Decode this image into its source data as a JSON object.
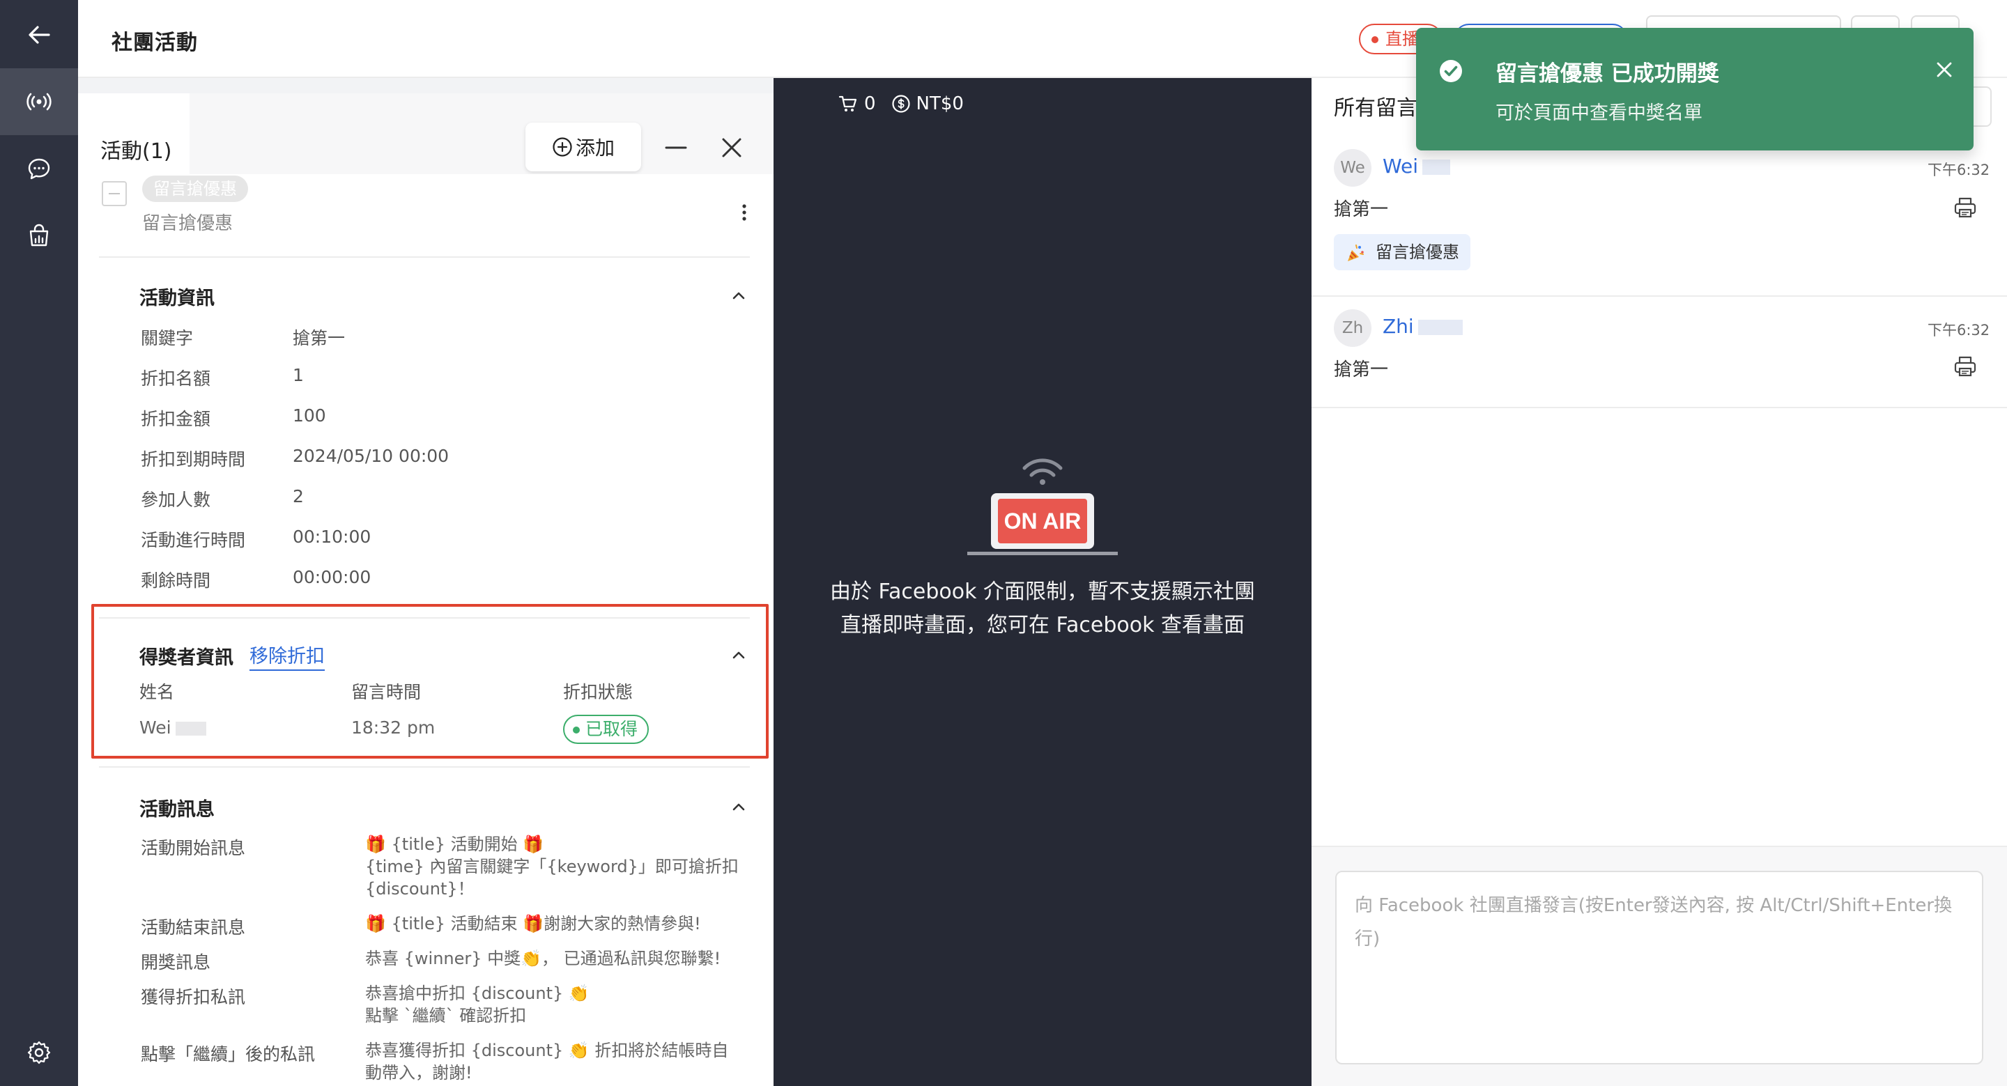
{
  "header": {
    "title": "社團活動",
    "live_badge": "直播"
  },
  "panel": {
    "title": "活動(1)",
    "add_label": "添加",
    "activity_tag": "留言搶優惠",
    "activity_name": "留言搶優惠"
  },
  "activity_info": {
    "title": "活動資訊",
    "rows": [
      {
        "label": "關鍵字",
        "value": "搶第一"
      },
      {
        "label": "折扣名額",
        "value": "1"
      },
      {
        "label": "折扣金額",
        "value": "100"
      },
      {
        "label": "折扣到期時間",
        "value": "2024/05/10 00:00"
      },
      {
        "label": "參加人數",
        "value": "2"
      },
      {
        "label": "活動進行時間",
        "value": "00:10:00"
      },
      {
        "label": "剩餘時間",
        "value": "00:00:00"
      }
    ]
  },
  "winner_info": {
    "title": "得獎者資訊",
    "remove_link": "移除折扣",
    "columns": [
      "姓名",
      "留言時間",
      "折扣狀態"
    ],
    "row": {
      "name": "Wei",
      "time": "18:32 pm",
      "status": "已取得"
    }
  },
  "activity_messages": {
    "title": "活動訊息",
    "items": [
      {
        "label": "活動開始訊息",
        "lines": [
          "🎁 {title} 活動開始 🎁",
          "{time} 內留言關鍵字「{keyword}」即可搶折扣",
          "{discount}！"
        ]
      },
      {
        "label": "活動結束訊息",
        "lines": [
          "🎁 {title} 活動結束 🎁謝謝大家的熱情參與!"
        ]
      },
      {
        "label": "開獎訊息",
        "lines": [
          "恭喜 {winner} 中獎👏， 已通過私訊與您聯繫!"
        ]
      },
      {
        "label": "獲得折扣私訊",
        "lines": [
          "恭喜搶中折扣 {discount} 👏",
          "點擊 `繼續` 確認折扣"
        ]
      },
      {
        "label": "點擊「繼續」後的私訊",
        "lines": [
          "恭喜獲得折扣 {discount} 👏 折扣將於結帳時自",
          "動帶入，謝謝!"
        ]
      }
    ]
  },
  "video": {
    "cart_count": "0",
    "amount": "NT$0",
    "onair_label": "ON AIR",
    "notice": "由於 Facebook 介面限制，暫不支援顯示社團直播即時畫面，您可在 Facebook 查看畫面"
  },
  "comments": {
    "title": "所有留言",
    "items": [
      {
        "avatar": "We",
        "name": "Wei",
        "time": "下午6:32",
        "text": "搶第一",
        "tag": "留言搶優惠"
      },
      {
        "avatar": "Zh",
        "name": "Zhi",
        "time": "下午6:32",
        "text": "搶第一"
      }
    ],
    "composer_placeholder": "向 Facebook 社團直播發言(按Enter發送內容, 按 Alt/Ctrl/Shift+Enter換行)"
  },
  "toast": {
    "title": "留言搶優惠 已成功開獎",
    "subtitle": "可於頁面中查看中獎名單"
  },
  "colors": {
    "sidebar": "#2e3240",
    "video_bg": "#262935",
    "accent_blue": "#2f6ad8",
    "success_green": "#3cae6b",
    "toast_green": "#3f8f68",
    "highlight_red": "#e0432f"
  }
}
